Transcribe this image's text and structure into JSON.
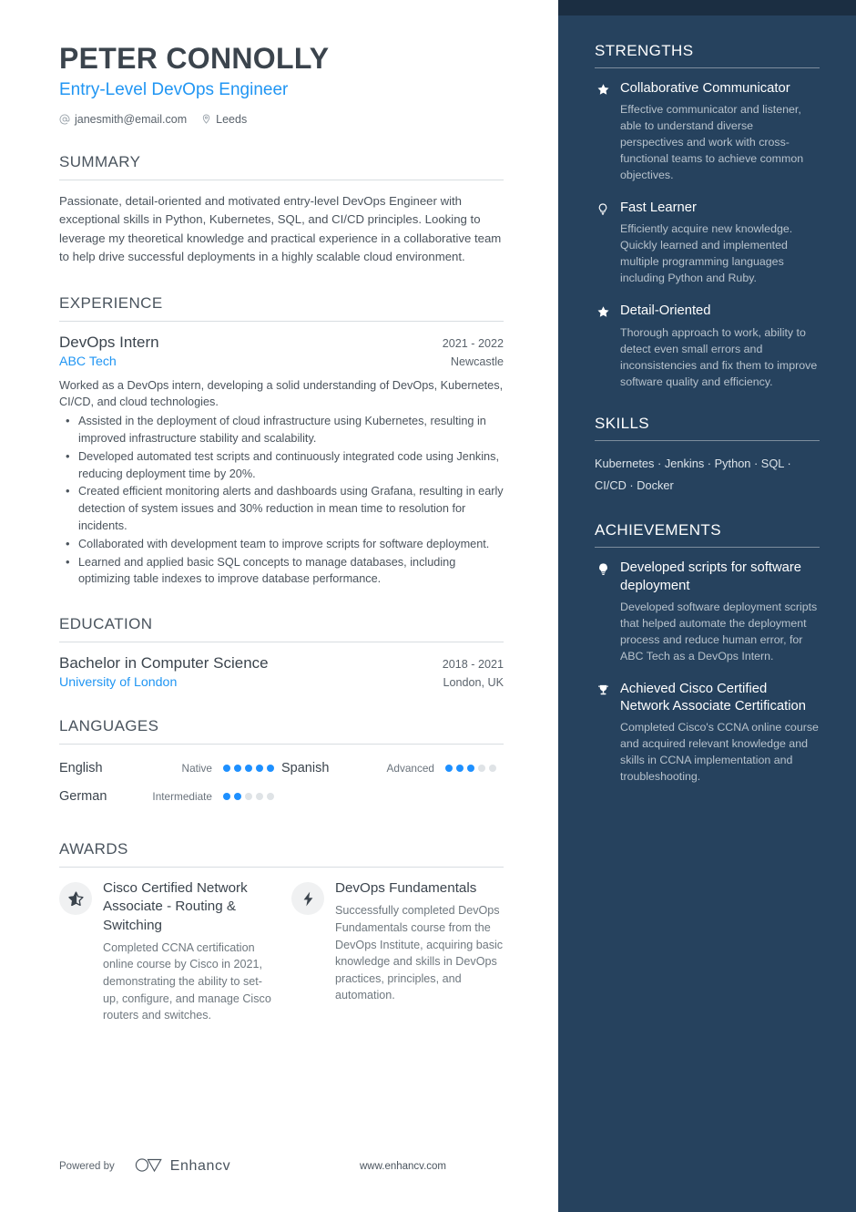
{
  "header": {
    "name": "PETER CONNOLLY",
    "headline": "Entry-Level DevOps Engineer",
    "email": "janesmith@email.com",
    "email_icon": "at-icon",
    "location": "Leeds",
    "location_icon": "map-pin-icon"
  },
  "summary": {
    "title": "SUMMARY",
    "text": "Passionate, detail-oriented and motivated entry-level DevOps Engineer with exceptional skills in Python, Kubernetes, SQL, and CI/CD principles. Looking to leverage my theoretical knowledge and practical experience in a collaborative team to help drive successful deployments in a highly scalable cloud environment."
  },
  "experience": {
    "title": "EXPERIENCE",
    "entries": [
      {
        "role": "DevOps Intern",
        "dates": "2021 - 2022",
        "company": "ABC Tech",
        "location": "Newcastle",
        "description": "Worked as a DevOps intern, developing a solid understanding of DevOps, Kubernetes, CI/CD, and cloud technologies.",
        "bullets": [
          "Assisted in the deployment of cloud infrastructure using Kubernetes, resulting in improved infrastructure stability and scalability.",
          "Developed automated test scripts and continuously integrated code using Jenkins, reducing deployment time by 20%.",
          "Created efficient monitoring alerts and dashboards using Grafana, resulting in early detection of system issues and 30% reduction in mean time to resolution for incidents.",
          "Collaborated with development team to improve scripts for software deployment.",
          "Learned and applied basic SQL concepts to manage databases, including optimizing table indexes to improve database performance."
        ]
      }
    ]
  },
  "education": {
    "title": "EDUCATION",
    "entries": [
      {
        "degree": "Bachelor in Computer Science",
        "dates": "2018 - 2021",
        "school": "University of London",
        "location": "London, UK"
      }
    ]
  },
  "languages": {
    "title": "LANGUAGES",
    "items": [
      {
        "name": "English",
        "level": "Native",
        "rating": 5,
        "max": 5
      },
      {
        "name": "Spanish",
        "level": "Advanced",
        "rating": 3,
        "max": 5
      },
      {
        "name": "German",
        "level": "Intermediate",
        "rating": 2,
        "max": 5
      }
    ]
  },
  "awards": {
    "title": "AWARDS",
    "items": [
      {
        "icon": "star-half-icon",
        "title": "Cisco Certified Network Associate - Routing & Switching",
        "description": "Completed CCNA certification online course by Cisco in 2021, demonstrating the ability to set-up, configure, and manage Cisco routers and switches."
      },
      {
        "icon": "lightning-bolt-icon",
        "title": "DevOps Fundamentals",
        "description": "Successfully completed DevOps Fundamentals course from the DevOps Institute, acquiring basic knowledge and skills in DevOps practices, principles, and automation."
      }
    ]
  },
  "strengths": {
    "title": "STRENGTHS",
    "items": [
      {
        "icon": "star-icon",
        "title": "Collaborative Communicator",
        "description": "Effective communicator and listener, able to understand diverse perspectives and work with cross-functional teams to achieve common objectives."
      },
      {
        "icon": "lightbulb-icon",
        "title": "Fast Learner",
        "description": "Efficiently acquire new knowledge. Quickly learned and implemented multiple programming languages including Python and Ruby."
      },
      {
        "icon": "star-icon",
        "title": "Detail-Oriented",
        "description": "Thorough approach to work, ability to detect even small errors and inconsistencies and fix them to improve software quality and efficiency."
      }
    ]
  },
  "skills": {
    "title": "SKILLS",
    "text": "Kubernetes · Jenkins · Python · SQL · CI/CD · Docker",
    "items": [
      "Kubernetes",
      "Jenkins",
      "Python",
      "SQL",
      "CI/CD",
      "Docker"
    ]
  },
  "achievements": {
    "title": "ACHIEVEMENTS",
    "items": [
      {
        "icon": "lightbulb-filled-icon",
        "title": "Developed scripts for software deployment",
        "description": "Developed software deployment scripts that helped automate the deployment process and reduce human error, for ABC Tech as a DevOps Intern."
      },
      {
        "icon": "trophy-icon",
        "title": "Achieved Cisco Certified Network Associate Certification",
        "description": "Completed Cisco's CCNA online course and acquired relevant knowledge and skills in CCNA implementation and troubleshooting."
      }
    ]
  },
  "footer": {
    "powered_by": "Powered by",
    "brand": "Enhancv",
    "brand_icon": "enhancv-logo-icon",
    "url": "www.enhancv.com"
  },
  "colors": {
    "accent_blue": "#2196f3",
    "sidebar_bg": "#26425e",
    "sidebar_top_band": "#1b2e42",
    "dot_active": "#1e90ff",
    "dot_inactive": "#dfe3e6"
  }
}
